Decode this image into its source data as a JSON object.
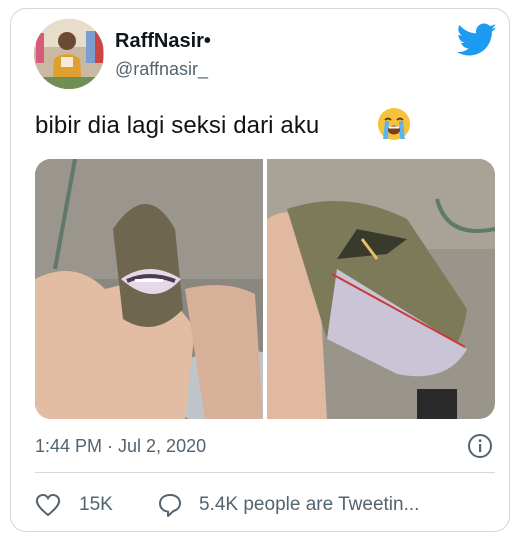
{
  "author": {
    "name": "RaffNasir•",
    "handle": "@raffnasir_"
  },
  "tweet": {
    "text": "bibir dia lagi seksi dari aku",
    "emoji": "loudly-crying-face-emoji"
  },
  "meta": {
    "timestamp": "1:44 PM · Jul 2, 2020"
  },
  "engagement": {
    "likes": "15K",
    "retweets_text": "5.4K people are Tweetin..."
  },
  "icons": [
    "twitter-bird-icon",
    "info-icon",
    "heart-icon",
    "chat-bubble-icon"
  ],
  "colors": {
    "brand": "#1d9bf0",
    "secondary_text": "#536471",
    "border": "#cfd9de"
  }
}
